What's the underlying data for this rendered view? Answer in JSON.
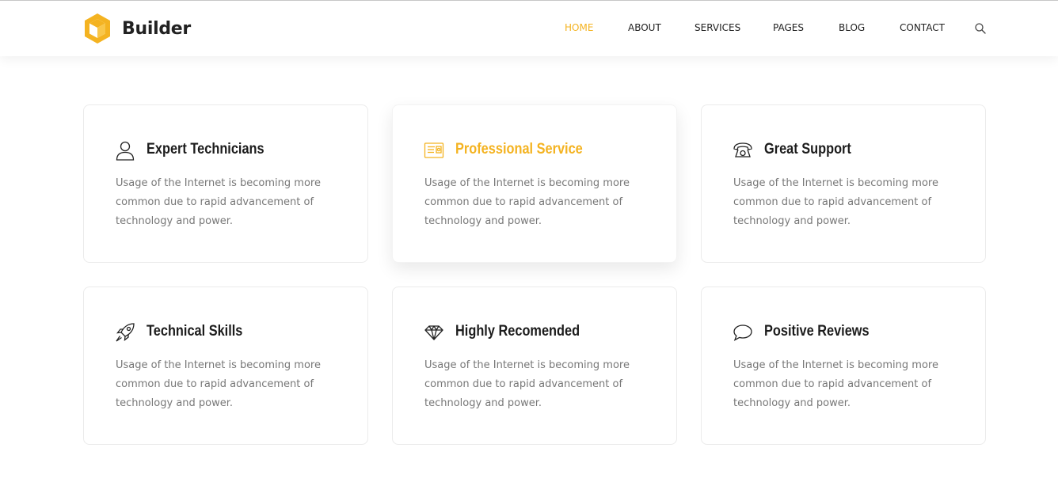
{
  "brand": {
    "name": "Builder",
    "accent": "#f4b321"
  },
  "nav": {
    "items": [
      {
        "label": "HOME",
        "active": true
      },
      {
        "label": "ABOUT"
      },
      {
        "label": "SERVICES"
      },
      {
        "label": "PAGES"
      },
      {
        "label": "BLOG"
      },
      {
        "label": "CONTACT"
      }
    ],
    "search_icon": "search-icon"
  },
  "features": [
    {
      "icon": "user-icon",
      "title": "Expert Technicians",
      "text": "Usage of the Internet is becoming more common due to rapid advancement of technology and power."
    },
    {
      "icon": "certificate-icon",
      "title": "Professional Service",
      "text": "Usage of the Internet is becoming more common due to rapid advancement of technology and power.",
      "highlighted": true
    },
    {
      "icon": "phone-icon",
      "title": "Great Support",
      "text": "Usage of the Internet is becoming more common due to rapid advancement of technology and power."
    },
    {
      "icon": "rocket-icon",
      "title": "Technical Skills",
      "text": "Usage of the Internet is becoming more common due to rapid advancement of technology and power."
    },
    {
      "icon": "diamond-icon",
      "title": "Highly Recomended",
      "text": "Usage of the Internet is becoming more common due to rapid advancement of technology and power."
    },
    {
      "icon": "chat-bubble-icon",
      "title": "Positive Reviews",
      "text": "Usage of the Internet is becoming more common due to rapid advancement of technology and power."
    }
  ]
}
